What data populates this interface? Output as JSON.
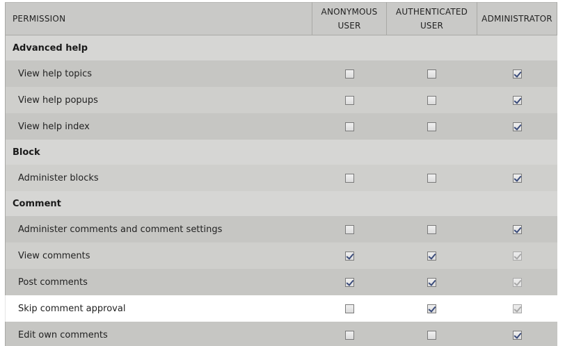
{
  "header": {
    "permission": "PERMISSION",
    "anonymous_line1": "ANONYMOUS",
    "anonymous_line2": "USER",
    "authenticated_line1": "AUTHENTICATED",
    "authenticated_line2": "USER",
    "administrator": "ADMINISTRATOR"
  },
  "modules": [
    {
      "name": "Advanced help",
      "permissions": [
        {
          "label": "View help topics",
          "anonymous": false,
          "authenticated": false,
          "administrator": true,
          "admin_disabled": false
        },
        {
          "label": "View help popups",
          "anonymous": false,
          "authenticated": false,
          "administrator": true,
          "admin_disabled": false
        },
        {
          "label": "View help index",
          "anonymous": false,
          "authenticated": false,
          "administrator": true,
          "admin_disabled": false
        }
      ]
    },
    {
      "name": "Block",
      "permissions": [
        {
          "label": "Administer blocks",
          "anonymous": false,
          "authenticated": false,
          "administrator": true,
          "admin_disabled": false
        }
      ]
    },
    {
      "name": "Comment",
      "permissions": [
        {
          "label": "Administer comments and comment settings",
          "anonymous": false,
          "authenticated": false,
          "administrator": true,
          "admin_disabled": false
        },
        {
          "label": "View comments",
          "anonymous": true,
          "authenticated": true,
          "administrator": true,
          "admin_disabled": true
        },
        {
          "label": "Post comments",
          "anonymous": true,
          "authenticated": true,
          "administrator": true,
          "admin_disabled": true
        },
        {
          "label": "Skip comment approval",
          "anonymous": false,
          "authenticated": true,
          "administrator": true,
          "admin_disabled": true,
          "highlighted": true
        },
        {
          "label": "Edit own comments",
          "anonymous": false,
          "authenticated": false,
          "administrator": true,
          "admin_disabled": false
        }
      ]
    }
  ],
  "colors": {
    "header_bg": "#c9c9c7",
    "module_bg": "#d6d6d4",
    "row_bg": "#c6c6c3",
    "highlight_bg": "#ffffff",
    "check_color": "#3a4b7a"
  }
}
